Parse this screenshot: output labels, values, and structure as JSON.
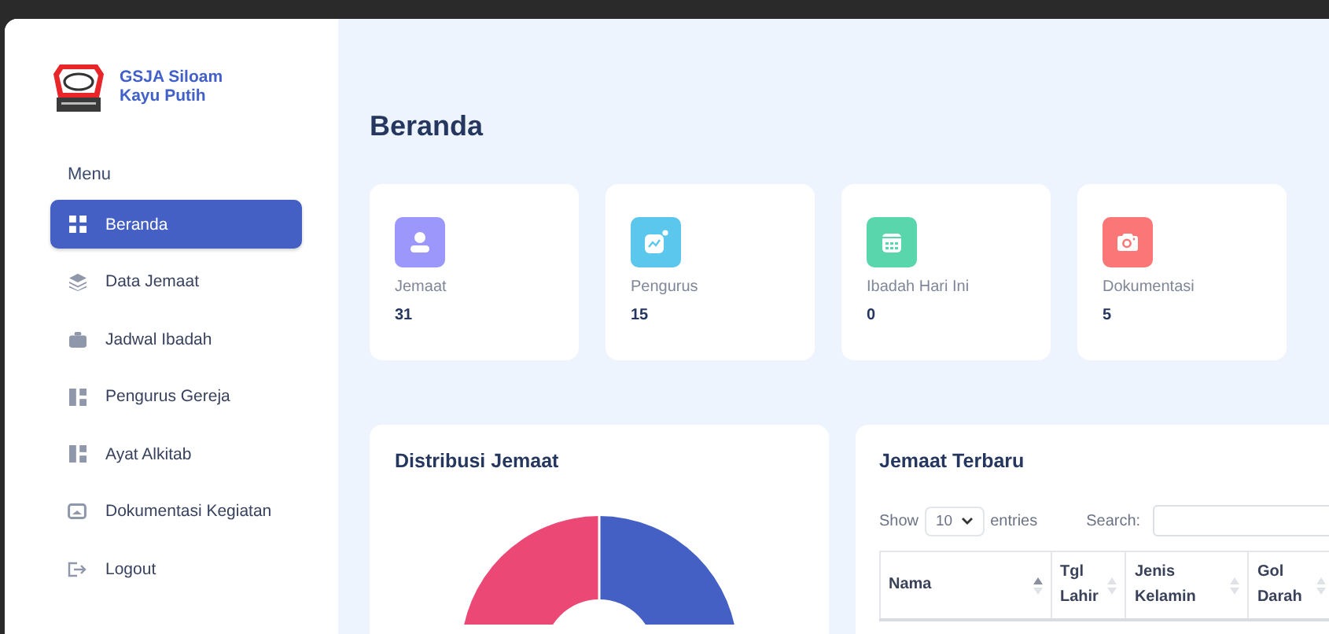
{
  "brand": {
    "name": "GSJA Siloam\nKayu Putih"
  },
  "sidebar": {
    "heading": "Menu",
    "items": [
      {
        "label": "Beranda",
        "selected": true
      },
      {
        "label": "Data Jemaat",
        "selected": false
      },
      {
        "label": "Jadwal Ibadah",
        "selected": false
      },
      {
        "label": "Pengurus Gereja",
        "selected": false
      },
      {
        "label": "Ayat Alkitab",
        "selected": false
      },
      {
        "label": "Dokumentasi Kegiatan",
        "selected": false
      },
      {
        "label": "Logout",
        "selected": false
      }
    ]
  },
  "page": {
    "title": "Beranda"
  },
  "stats": [
    {
      "label": "Jemaat",
      "value": "31",
      "color": "#9b97fb"
    },
    {
      "label": "Pengurus",
      "value": "15",
      "color": "#5bc7ec"
    },
    {
      "label": "Ibadah Hari Ini",
      "value": "0",
      "color": "#5ad6ac"
    },
    {
      "label": "Dokumentasi",
      "value": "5",
      "color": "#fb7676"
    }
  ],
  "distribution": {
    "title": "Distribusi Jemaat"
  },
  "latest": {
    "title": "Jemaat Terbaru",
    "show_label": "Show",
    "page_size": "10",
    "entries_label": "entries",
    "search_label": "Search:",
    "columns": [
      {
        "label": "Nama",
        "sorted": true
      },
      {
        "label": "Tgl\nLahir",
        "sorted": false
      },
      {
        "label": "Jenis\nKelamin",
        "sorted": false
      },
      {
        "label": "Gol\nDarah",
        "sorted": false
      }
    ]
  }
}
